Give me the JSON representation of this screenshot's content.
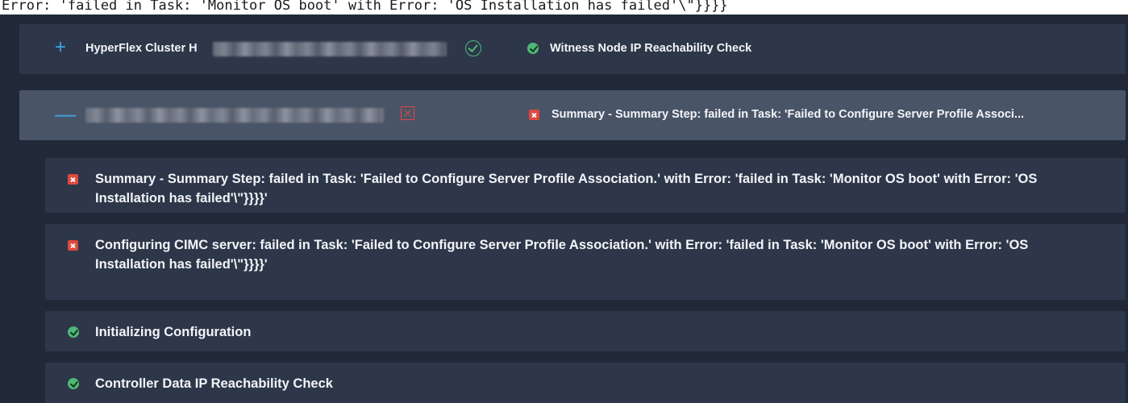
{
  "top_banner_text": "Error: 'failed in Task: 'Monitor OS boot' with Error: 'OS Installation has failed'\\\"}}}}",
  "colors": {
    "accent": "#3fa4e6",
    "success": "#4fb777",
    "error": "#e0483f",
    "row_bg": "#2d3749",
    "row_active_bg": "#4a5467"
  },
  "rows": [
    {
      "expand_icon": "plus-icon",
      "name_label": "HyperFlex Cluster H",
      "status_icon": "check-circle-icon",
      "status_text": "Witness Node IP Reachability Check",
      "status_state": "success"
    },
    {
      "expand_icon": "minus-icon",
      "status_icon": "x-square-icon",
      "status_text": "Summary - Summary Step: failed in Task: 'Failed to Configure Server Profile Associ...",
      "status_state": "error"
    }
  ],
  "details": [
    {
      "state": "error",
      "text": "Summary - Summary Step: failed in Task: 'Failed to Configure Server Profile Association.' with Error: 'failed in Task: 'Monitor OS boot' with Error: 'OS Installation has failed'\\\"}}}}'"
    },
    {
      "state": "error",
      "text": "Configuring CIMC server: failed in Task: 'Failed to Configure Server Profile Association.' with Error: 'failed in Task: 'Monitor OS boot' with Error: 'OS Installation has failed'\\\"}}}}'"
    },
    {
      "state": "success",
      "text": "Initializing Configuration"
    },
    {
      "state": "success",
      "text": "Controller Data IP Reachability Check"
    }
  ]
}
